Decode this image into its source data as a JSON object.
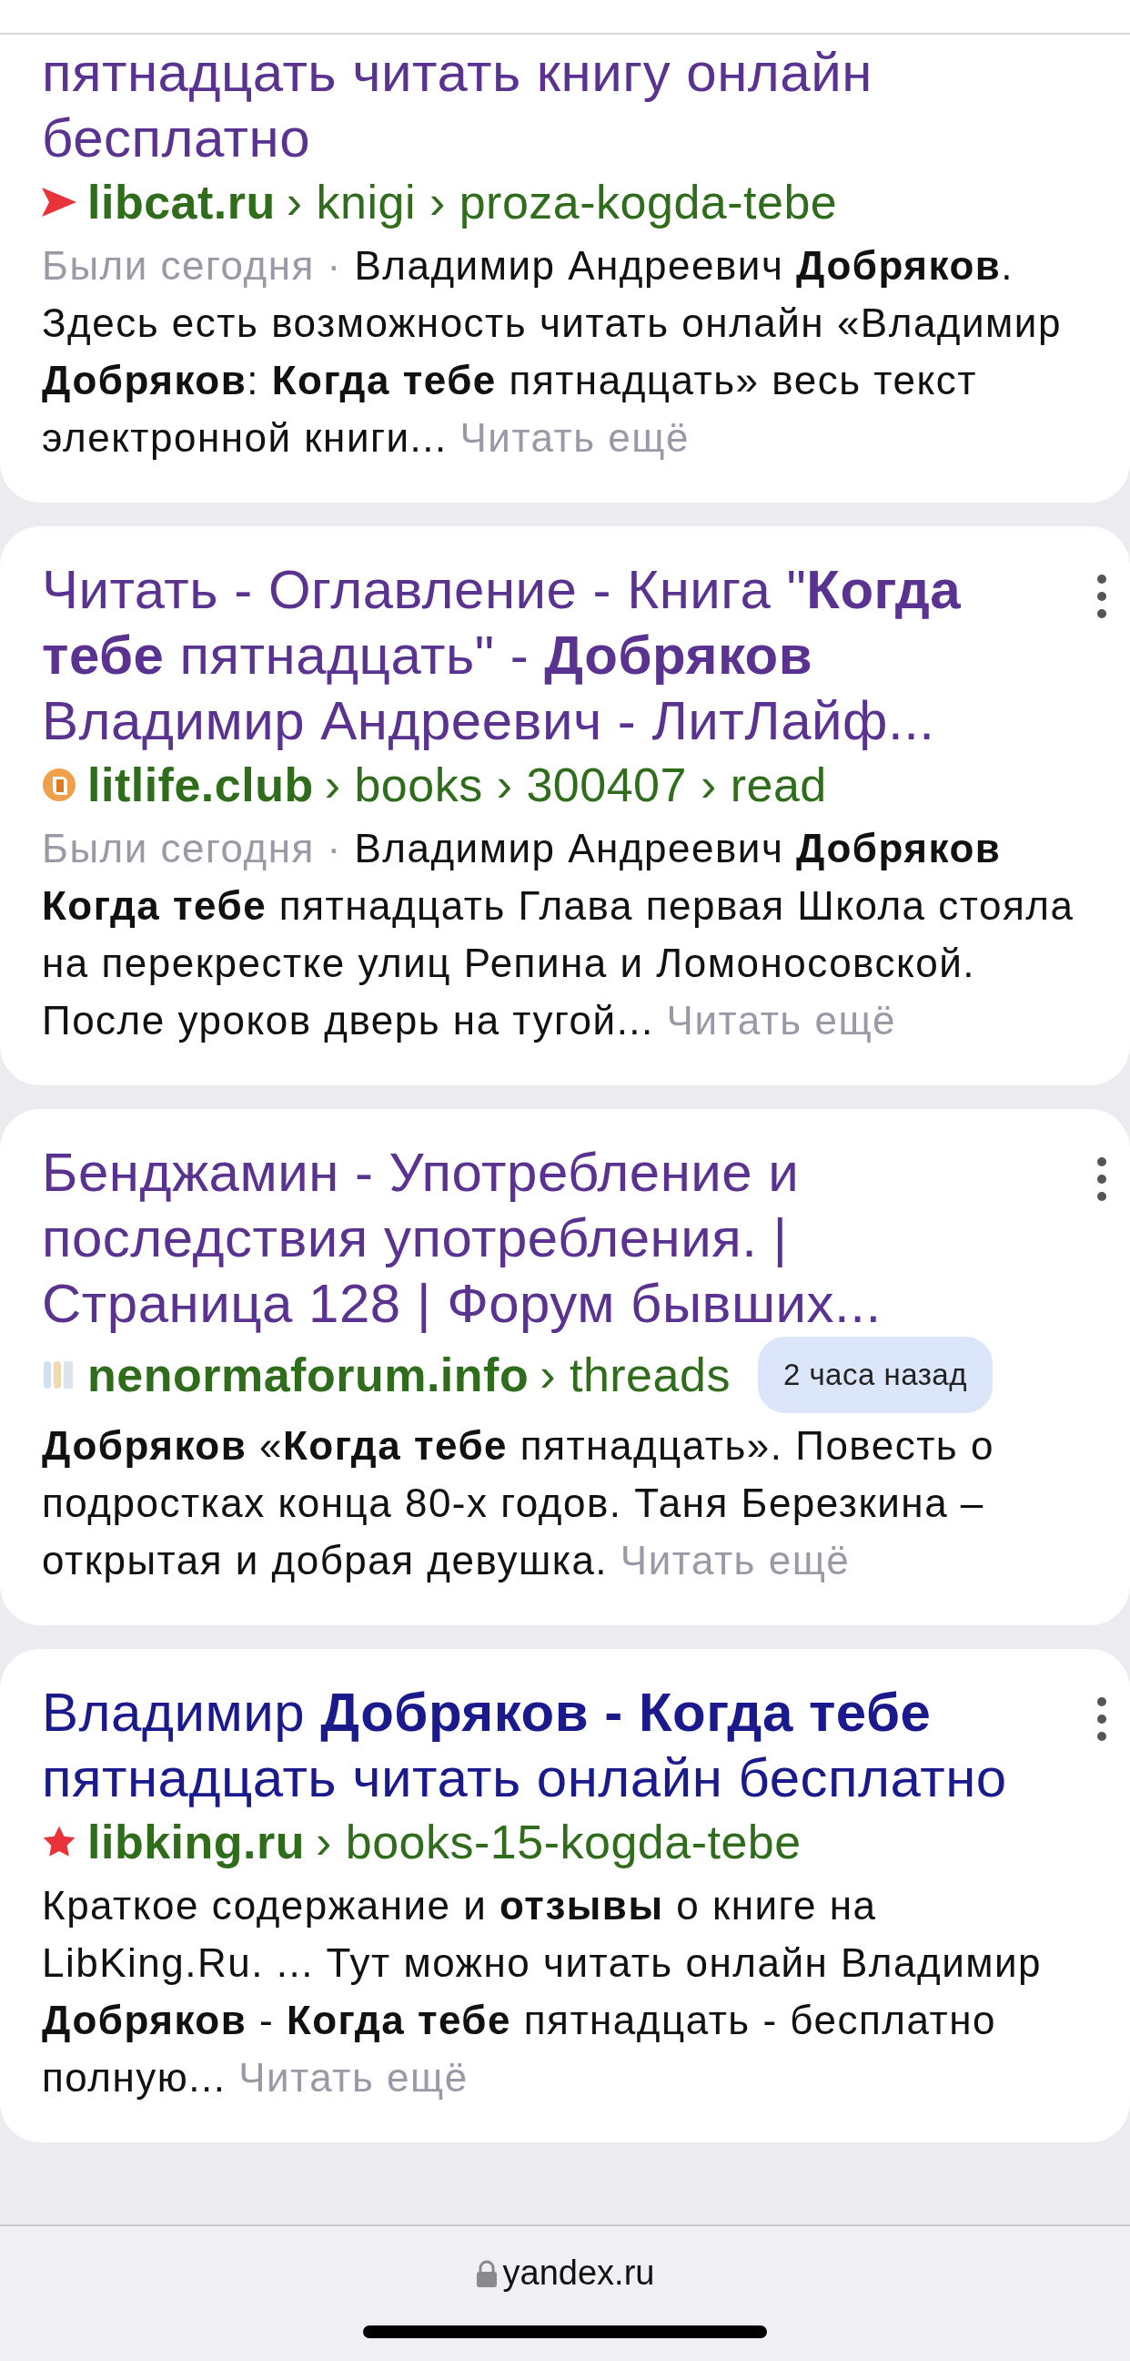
{
  "results": [
    {
      "title": "пятнадцать читать книгу онлайн бесплатно",
      "visited": true,
      "menu": false,
      "domain": "libcat.ru",
      "path": "› knigi › proza-kogda-tebe",
      "visit_note": "Были сегодня ·",
      "snippet": "Владимир Андреевич **Добряков**. Здесь есть возможность читать онлайн «Владимир **Добряков**: **Когда тебе** пятнадцать» весь текст электронной книги...",
      "more": "Читать ещё"
    },
    {
      "title": "Читать - Оглавление - Книга \"**Когда тебе** пятнадцать\" - **Добряков** Владимир Андреевич - ЛитЛайф...",
      "visited": true,
      "menu": true,
      "domain": "litlife.club",
      "path": "› books › 300407 › read",
      "visit_note": "Были сегодня ·",
      "snippet": "Владимир Андреевич **Добряков** **Когда тебе** пятнадцать Глава первая Школа стояла на перекрестке улиц Репина и Ломоносовской. После уроков дверь на тугой...",
      "more": "Читать ещё"
    },
    {
      "title": "Бенджамин - Употребление и последствия употребления. | Страница 128 | Форум бывших...",
      "visited": true,
      "menu": true,
      "domain": "nenormaforum.info",
      "path": "› threads",
      "badge": "2 часа назад",
      "snippet": "**Добряков** «**Когда тебе** пятнадцать». Повесть о подростках конца 80-х годов. Таня Березкина – открытая и добрая девушка.",
      "more": "Читать ещё"
    },
    {
      "title": "Владимир **Добряков - Когда тебе** пятнадцать читать онлайн бесплатно",
      "visited": false,
      "menu": true,
      "domain": "libking.ru",
      "path": "› books-15-kogda-tebe",
      "snippet": "Краткое содержание и **отзывы** о книге на LibKing.Ru. ... Тут можно читать онлайн Владимир **Добряков** - **Когда тебе** пятнадцать - бесплатно полную...",
      "more": "Читать ещё"
    }
  ],
  "address_bar": {
    "url": "yandex.ru"
  }
}
